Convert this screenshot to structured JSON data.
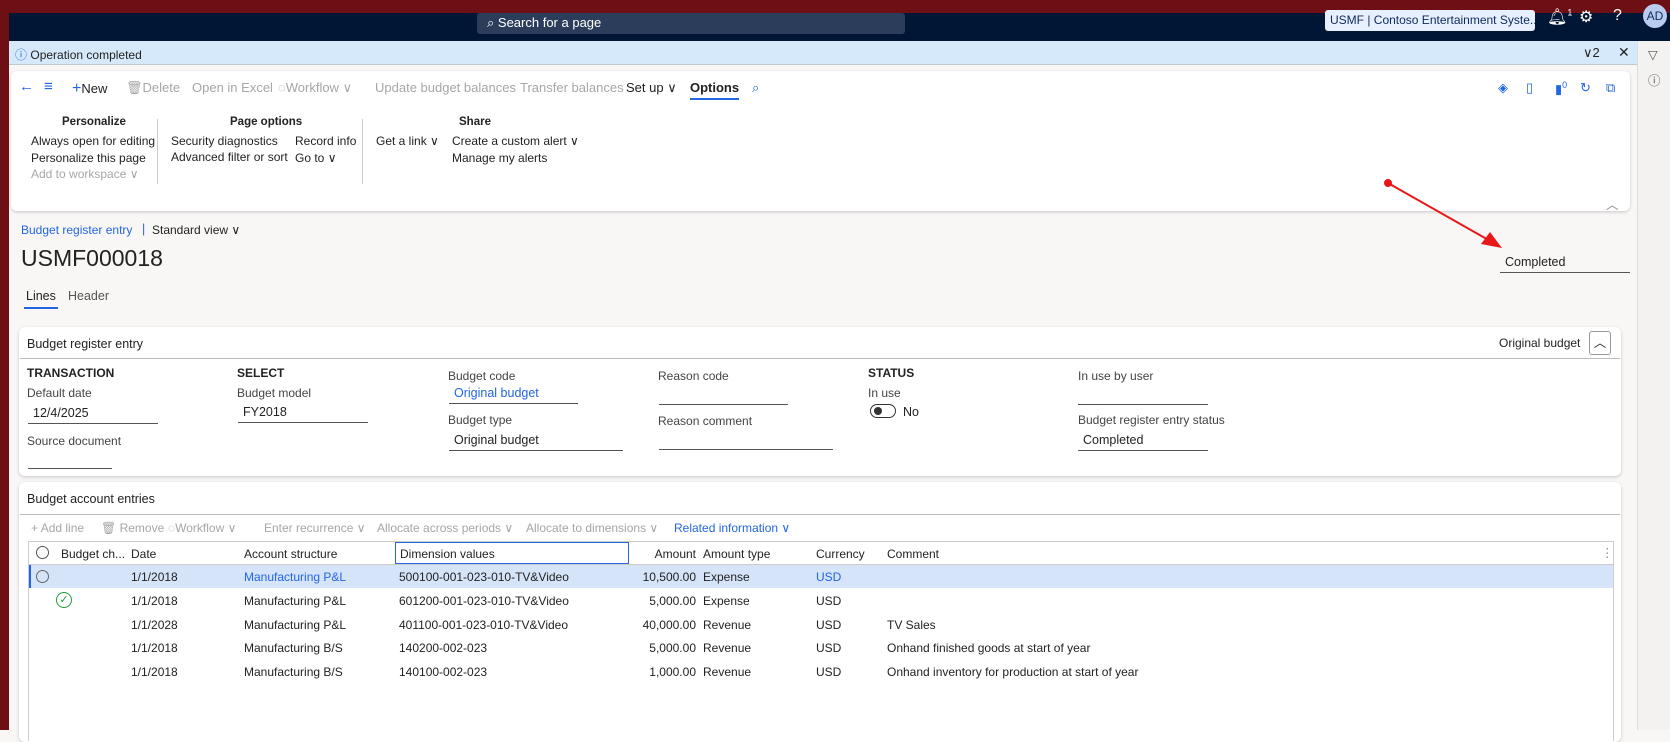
{
  "nav": {
    "search_placeholder": "Search for a page",
    "company": "USMF | Contoso Entertainment Syste...",
    "notification_count": "1",
    "avatar": "AD"
  },
  "notification": {
    "message": "Operation completed",
    "count": "2"
  },
  "actions": {
    "new": "New",
    "delete": "Delete",
    "open_excel": "Open in Excel",
    "workflow": "Workflow",
    "update_budget": "Update budget balances",
    "transfer": "Transfer balances",
    "setup": "Set up",
    "options": "Options",
    "badge": "0"
  },
  "options": {
    "personalize": {
      "title": "Personalize",
      "items": [
        "Always open for editing",
        "Personalize this page",
        "Add to workspace"
      ]
    },
    "page_options": {
      "title": "Page options",
      "items": [
        "Security diagnostics",
        "Advanced filter or sort",
        "Record info",
        "Go to"
      ]
    },
    "share": {
      "title": "Share",
      "items": [
        "Get a link",
        "Create a custom alert",
        "Manage my alerts"
      ]
    }
  },
  "page": {
    "breadcrumb": "Budget register entry",
    "view": "Standard view",
    "title": "USMF000018",
    "status": "Completed",
    "tabs": [
      "Lines",
      "Header"
    ]
  },
  "header_card": {
    "title": "Budget register entry",
    "summary": "Original budget",
    "transaction": "TRANSACTION",
    "default_date_label": "Default date",
    "default_date": "12/4/2025",
    "source_doc_label": "Source document",
    "select": "SELECT",
    "budget_model_label": "Budget model",
    "budget_model": "FY2018",
    "budget_code_label": "Budget code",
    "budget_code": "Original budget",
    "budget_type_label": "Budget type",
    "budget_type": "Original budget",
    "reason_code_label": "Reason code",
    "reason_comment_label": "Reason comment",
    "status": "STATUS",
    "in_use_label": "In use",
    "in_use": "No",
    "in_use_by_label": "In use by user",
    "entry_status_label": "Budget register entry status",
    "entry_status": "Completed"
  },
  "lines": {
    "title": "Budget account entries",
    "toolbar": [
      "Add line",
      "Remove",
      "Workflow",
      "Enter recurrence",
      "Allocate across periods",
      "Allocate to dimensions",
      "Related information"
    ],
    "columns": [
      "Budget ch...",
      "Date",
      "Account structure",
      "Dimension values",
      "Amount",
      "Amount type",
      "Currency",
      "Comment"
    ],
    "rows": [
      {
        "check": "",
        "date": "1/1/2018",
        "account": "Manufacturing P&L",
        "dim": "500100-001-023-010-TV&Video",
        "amount": "10,500.00",
        "type": "Expense",
        "currency": "USD",
        "comment": ""
      },
      {
        "check": "ok",
        "date": "1/1/2018",
        "account": "Manufacturing P&L",
        "dim": "601200-001-023-010-TV&Video",
        "amount": "5,000.00",
        "type": "Expense",
        "currency": "USD",
        "comment": ""
      },
      {
        "check": "",
        "date": "1/1/2028",
        "account": "Manufacturing P&L",
        "dim": "401100-001-023-010-TV&Video",
        "amount": "40,000.00",
        "type": "Revenue",
        "currency": "USD",
        "comment": "TV Sales"
      },
      {
        "check": "",
        "date": "1/1/2018",
        "account": "Manufacturing B/S",
        "dim": "140200-002-023",
        "amount": "5,000.00",
        "type": "Revenue",
        "currency": "USD",
        "comment": "Onhand finished goods at start of year"
      },
      {
        "check": "",
        "date": "1/1/2018",
        "account": "Manufacturing B/S",
        "dim": "140100-002-023",
        "amount": "1,000.00",
        "type": "Revenue",
        "currency": "USD",
        "comment": "Onhand inventory for production at start of year"
      }
    ]
  },
  "colors": {
    "accent": "#2266e3",
    "nav": "#011535",
    "selected_row": "#d6e4fa",
    "annotation_arrow": "#e81818"
  }
}
